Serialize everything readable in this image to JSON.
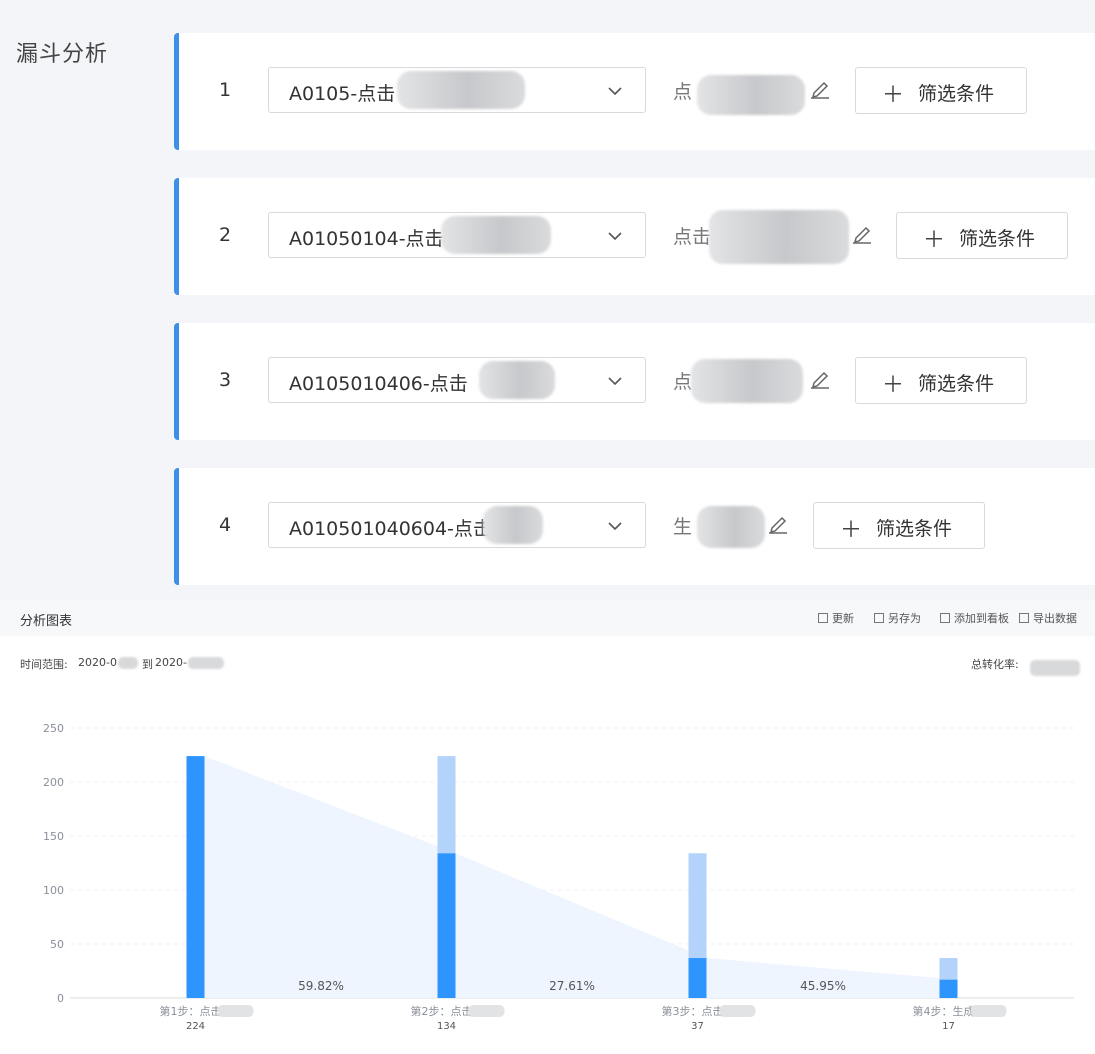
{
  "page_title": "漏斗分析",
  "steps": [
    {
      "number": "1",
      "event": "A0105-点击",
      "alias": "点",
      "filter_label": "筛选条件"
    },
    {
      "number": "2",
      "event": "A01050104-点击",
      "alias": "点击",
      "filter_label": "筛选条件"
    },
    {
      "number": "3",
      "event": "A0105010406-点击",
      "alias": "点",
      "filter_label": "筛选条件"
    },
    {
      "number": "4",
      "event": "A010501040604-点击",
      "alias": "生",
      "filter_label": "筛选条件"
    }
  ],
  "chart_panel": {
    "title": "分析图表",
    "toolbar": [
      "更新",
      "另存为",
      "添加到看板",
      "导出数据"
    ],
    "time_range_label": "时间范围:",
    "time_range_start": "2020-0",
    "time_range_sep": "到",
    "time_range_end": "2020-",
    "total_conversion_label": "总转化率:"
  },
  "chart_data": {
    "type": "bar",
    "categories": [
      "第1步：点击",
      "第2步：点击",
      "第3步：点击",
      "第4步：生成"
    ],
    "series": [
      {
        "name": "",
        "values": [
          224,
          134,
          37,
          17
        ],
        "color": "#2e95ff"
      },
      {
        "name": "",
        "values": [
          224,
          224,
          134,
          37
        ],
        "color": "#b3d3fb"
      }
    ],
    "counts": [
      "224",
      "134",
      "37",
      "17"
    ],
    "conversion_rates": [
      "59.82%",
      "27.61%",
      "45.95%"
    ],
    "ylim": [
      0,
      250
    ],
    "yticks": [
      "0",
      "50",
      "100",
      "150",
      "200",
      "250"
    ],
    "area_color": "#eef5fe",
    "grid": true,
    "title": "",
    "xlabel": "",
    "ylabel": ""
  }
}
